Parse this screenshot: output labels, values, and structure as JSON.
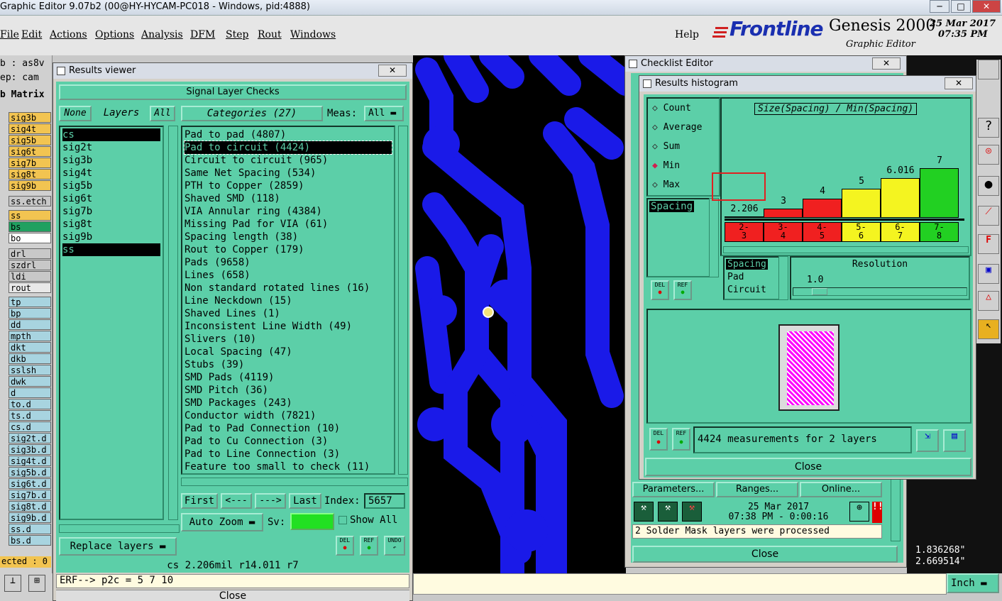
{
  "window": {
    "title": "Graphic Editor 9.07b2 (00@HY-HYCAM-PC018 - Windows, pid:4888)"
  },
  "menu": [
    "File",
    "Edit",
    "Actions",
    "Options",
    "Analysis",
    "DFM",
    "Step",
    "Rout",
    "Windows"
  ],
  "help": "Help",
  "brand": {
    "logo": "Frontline",
    "product": "Genesis 2000",
    "subtitle": "Graphic Editor",
    "date": "25 Mar 2017",
    "time": "07:35 PM"
  },
  "left": {
    "job": "b : as8v",
    "step": "ep: cam",
    "matrix": "b Matrix",
    "layers": [
      {
        "name": "sig3b",
        "color": "#f2c451"
      },
      {
        "name": "sig4t",
        "color": "#f2c451"
      },
      {
        "name": "sig5b",
        "color": "#f2c451"
      },
      {
        "name": "sig6t",
        "color": "#f2c451"
      },
      {
        "name": "sig7b",
        "color": "#f2c451"
      },
      {
        "name": "sig8t",
        "color": "#f2c451"
      },
      {
        "name": "sig9b",
        "color": "#f2c451"
      },
      {
        "name": "ss.etch",
        "color": "#c8c8c8"
      },
      {
        "name": "ss",
        "color": "#f2c451"
      },
      {
        "name": "bs",
        "color": "#20a060"
      },
      {
        "name": "bo",
        "color": "#ffffff"
      },
      {
        "name": "drl",
        "color": "#c8c8c8"
      },
      {
        "name": "szdrl",
        "color": "#c8c8c8"
      },
      {
        "name": "ldi",
        "color": "#c8c8c8"
      },
      {
        "name": "rout",
        "color": "#e8e8e8"
      },
      {
        "name": "tp",
        "color": "#a8d4e0"
      },
      {
        "name": "bp",
        "color": "#a8d4e0"
      },
      {
        "name": "dd",
        "color": "#a8d4e0"
      },
      {
        "name": "mpth",
        "color": "#a8d4e0"
      },
      {
        "name": "dkt",
        "color": "#a8d4e0"
      },
      {
        "name": "dkb",
        "color": "#a8d4e0"
      },
      {
        "name": "sslsh",
        "color": "#a8d4e0"
      },
      {
        "name": "dwk",
        "color": "#a8d4e0"
      },
      {
        "name": "d",
        "color": "#a8d4e0"
      },
      {
        "name": "to.d",
        "color": "#a8d4e0"
      },
      {
        "name": "ts.d",
        "color": "#a8d4e0"
      },
      {
        "name": "cs.d",
        "color": "#a8d4e0"
      },
      {
        "name": "sig2t.d",
        "color": "#a8d4e0"
      },
      {
        "name": "sig3b.d",
        "color": "#a8d4e0"
      },
      {
        "name": "sig4t.d",
        "color": "#a8d4e0"
      },
      {
        "name": "sig5b.d",
        "color": "#a8d4e0"
      },
      {
        "name": "sig6t.d",
        "color": "#a8d4e0"
      },
      {
        "name": "sig7b.d",
        "color": "#a8d4e0"
      },
      {
        "name": "sig8t.d",
        "color": "#a8d4e0"
      },
      {
        "name": "sig9b.d",
        "color": "#a8d4e0"
      },
      {
        "name": "ss.d",
        "color": "#a8d4e0"
      },
      {
        "name": "bs.d",
        "color": "#a8d4e0"
      }
    ],
    "selected": "ected : 0"
  },
  "results_viewer": {
    "title": "Results viewer",
    "header": "Signal Layer Checks",
    "none_btn": "None",
    "layers_label": "Layers",
    "all_btn": "All",
    "categories_label": "Categories (27)",
    "meas_label": "Meas:",
    "meas_value": "All",
    "layers": [
      "cs",
      "sig2t",
      "sig3b",
      "sig4t",
      "sig5b",
      "sig6t",
      "sig7b",
      "sig8t",
      "sig9b",
      "ss"
    ],
    "categories": [
      "Pad to pad (4807)",
      "Pad to circuit (4424)",
      "Circuit to circuit (965)",
      "Same Net Spacing (534)",
      "PTH to Copper (2859)",
      "Shaved SMD (118)",
      "VIA Annular ring (4384)",
      "Missing Pad for VIA (61)",
      "Spacing length (38)",
      "Rout to Copper (179)",
      "Pads (9658)",
      "Lines (658)",
      "Non standard rotated lines (16)",
      "Line Neckdown (15)",
      "Shaved Lines (1)",
      "Inconsistent Line Width (49)",
      "Slivers (10)",
      "Local Spacing (47)",
      "Stubs (39)",
      "SMD Pads (4119)",
      "SMD Pitch (36)",
      "SMD Packages (243)",
      "Conductor width (7821)",
      "Pad to Pad Connection (10)",
      "Pad to Cu Connection (3)",
      "Pad to Line Connection (3)",
      "Feature too small to check (11)"
    ],
    "first": "First",
    "prev": "<---",
    "next": "--->",
    "last": "Last",
    "index_label": "Index:",
    "index_value": "5657",
    "auto_zoom": "Auto Zoom",
    "sv_label": "Sv:",
    "show_all": "Show All",
    "replace_layers": "Replace layers",
    "del": "DEL",
    "ref": "REF",
    "undo": "UNDO",
    "status": "cs 2.206mil  r14.011  r7",
    "close": "Close"
  },
  "erf_line": "ERF--> p2c = 5 7 10",
  "checklist": {
    "title": "Checklist Editor",
    "parameters": "Parameters...",
    "ranges": "Ranges...",
    "online": "Online...",
    "date": "25 Mar 2017",
    "time_line": "07:38 PM - 0:00:16",
    "message": "2 Solder Mask layers were processed",
    "close": "Close"
  },
  "histogram": {
    "title": "Results histogram",
    "modes": [
      "Count",
      "Average",
      "Sum",
      "Min",
      "Max"
    ],
    "selected_mode": "Min",
    "list": [
      "Spacing"
    ],
    "graph_title": "Size(Spacing) / Min(Spacing)",
    "resolution_label": "Resolution",
    "resolution_value": "1.0",
    "types": [
      "Spacing",
      "Pad",
      "Circuit"
    ],
    "summary": "4424 measurements for 2 layers",
    "del": "DEL",
    "ref": "REF",
    "close": "Close",
    "colors": {
      "red": "#f02020",
      "yellow": "#f4f420",
      "green": "#22d022"
    }
  },
  "chart_data": {
    "type": "bar",
    "title": "Size(Spacing) / Min(Spacing)",
    "categories": [
      "2-3",
      "3-4",
      "4-5",
      "5-6",
      "6-7",
      "7-8"
    ],
    "values": [
      2.206,
      3,
      4,
      5,
      6.016,
      7
    ],
    "value_labels": [
      "2.206",
      "3",
      "4",
      "5",
      "6.016",
      "7"
    ],
    "colors": [
      "#f02020",
      "#f02020",
      "#f02020",
      "#f4f420",
      "#f4f420",
      "#22d022"
    ]
  },
  "coords": {
    "x": "1.836268\"",
    "y": "2.669514\""
  },
  "units": "Inch"
}
